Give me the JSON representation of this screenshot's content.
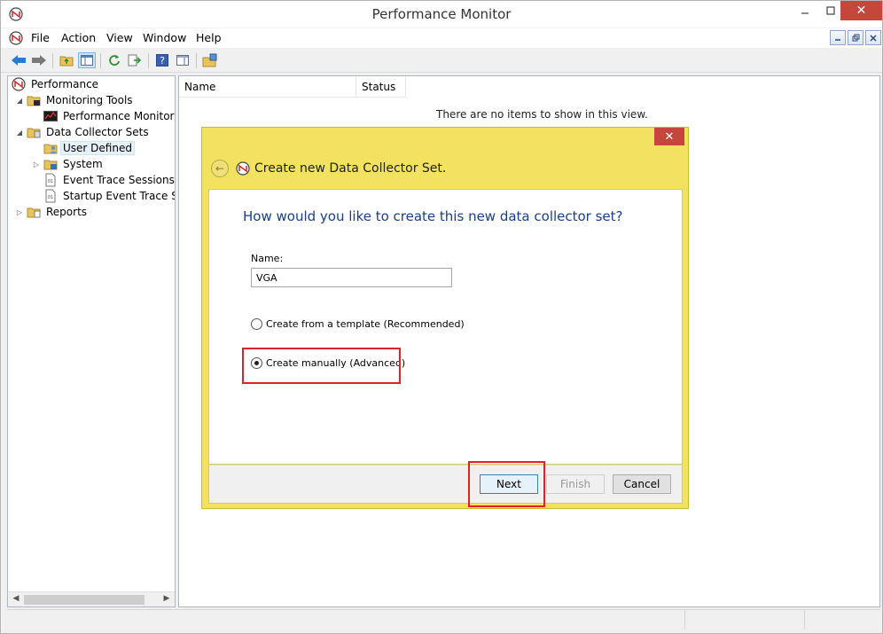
{
  "window": {
    "title": "Performance Monitor"
  },
  "menu": {
    "items": [
      "File",
      "Action",
      "View",
      "Window",
      "Help"
    ]
  },
  "tree": {
    "root": "Performance",
    "monitoring_tools": "Monitoring Tools",
    "performance_monitor": "Performance Monitor",
    "data_collector_sets": "Data Collector Sets",
    "user_defined": "User Defined",
    "system": "System",
    "event_trace_sessions": "Event Trace Sessions",
    "startup_event_trace": "Startup Event Trace Ses",
    "reports": "Reports"
  },
  "list": {
    "columns": [
      "Name",
      "Status"
    ],
    "empty_message": "There are no items to show in this view."
  },
  "wizard": {
    "title": "Create new Data Collector Set.",
    "question": "How would you like to create this new data collector set?",
    "name_label": "Name:",
    "name_value": "VGA",
    "option_template": "Create from a template (Recommended)",
    "option_manual": "Create manually (Advanced)",
    "selected_option": "manual",
    "next_label": "Next",
    "finish_label": "Finish",
    "cancel_label": "Cancel"
  },
  "colors": {
    "wizard_frame": "#f2e260",
    "close_red": "#c7463c",
    "question_blue": "#1a3e8c",
    "highlight_red": "#e0202a"
  }
}
